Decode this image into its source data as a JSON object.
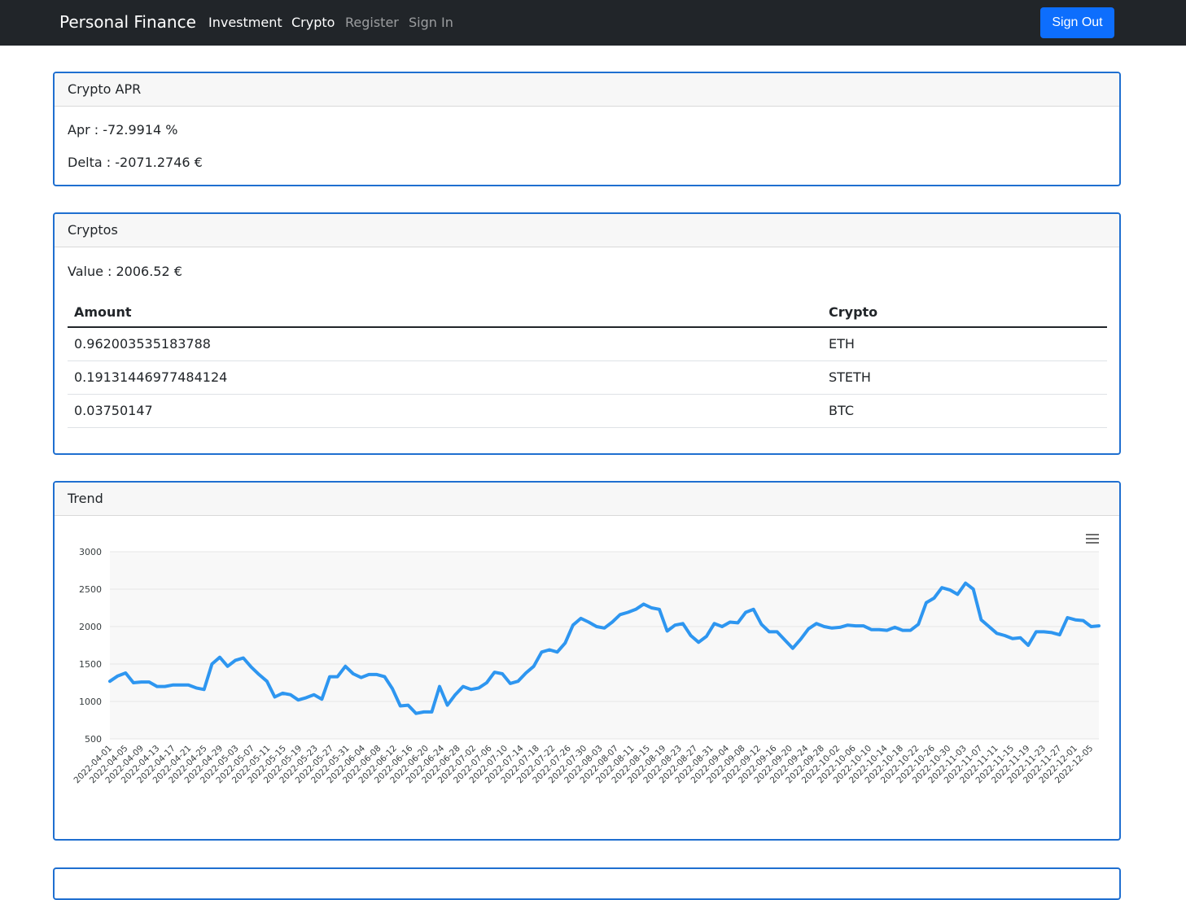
{
  "navbar": {
    "brand": "Personal Finance",
    "links": [
      {
        "label": "Investment",
        "state": "active"
      },
      {
        "label": "Crypto",
        "state": "active"
      },
      {
        "label": "Register",
        "state": "muted"
      },
      {
        "label": "Sign In",
        "state": "muted"
      }
    ],
    "sign_out": "Sign Out"
  },
  "apr_card": {
    "title": "Crypto APR",
    "apr": "Apr : -72.9914 %",
    "delta": "Delta : -2071.2746 €"
  },
  "cryptos_card": {
    "title": "Cryptos",
    "value": "Value : 2006.52 €",
    "headers": [
      "Amount",
      "Crypto"
    ],
    "rows": [
      {
        "amount": "0.962003535183788",
        "crypto": "ETH"
      },
      {
        "amount": "0.19131446977484124",
        "crypto": "STETH"
      },
      {
        "amount": "0.03750147",
        "crypto": "BTC"
      }
    ]
  },
  "trend_card": {
    "title": "Trend",
    "menu_icon": "hamburger-menu-icon"
  },
  "colors": {
    "line": "#2e96f0",
    "card_border": "#1f6fd0",
    "navbar": "#212529",
    "button": "#0d6efd"
  },
  "chart_data": {
    "type": "line",
    "x_start": "2022-04-01",
    "x_end": "2022-12-07",
    "tick_every_days": 4,
    "ylim": [
      500,
      3000
    ],
    "yticks": [
      500,
      1000,
      1500,
      2000,
      2500,
      3000
    ],
    "grid": true,
    "series": [
      {
        "values": [
          1270,
          1340,
          1380,
          1250,
          1260,
          1260,
          1200,
          1200,
          1220,
          1220,
          1220,
          1180,
          1160,
          1500,
          1590,
          1470,
          1550,
          1580,
          1460,
          1360,
          1270,
          1060,
          1110,
          1090,
          1020,
          1050,
          1090,
          1030,
          1330,
          1330,
          1470,
          1370,
          1320,
          1360,
          1360,
          1330,
          1170,
          940,
          950,
          840,
          860,
          860,
          1200,
          950,
          1090,
          1200,
          1160,
          1180,
          1250,
          1390,
          1370,
          1240,
          1270,
          1380,
          1470,
          1660,
          1690,
          1660,
          1780,
          2020,
          2110,
          2060,
          2000,
          1980,
          2060,
          2160,
          2190,
          2230,
          2300,
          2250,
          2230,
          1940,
          2020,
          2040,
          1880,
          1790,
          1870,
          2040,
          2000,
          2060,
          2050,
          2190,
          2230,
          2030,
          1930,
          1930,
          1820,
          1710,
          1830,
          1970,
          2040,
          2000,
          1980,
          1990,
          2020,
          2010,
          2010,
          1960,
          1960,
          1950,
          1990,
          1950,
          1950,
          2030,
          2320,
          2380,
          2520,
          2490,
          2430,
          2580,
          2500,
          2090,
          2000,
          1910,
          1880,
          1840,
          1850,
          1750,
          1930,
          1930,
          1920,
          1890,
          2120,
          2090,
          2080,
          2000,
          2010
        ]
      }
    ]
  }
}
